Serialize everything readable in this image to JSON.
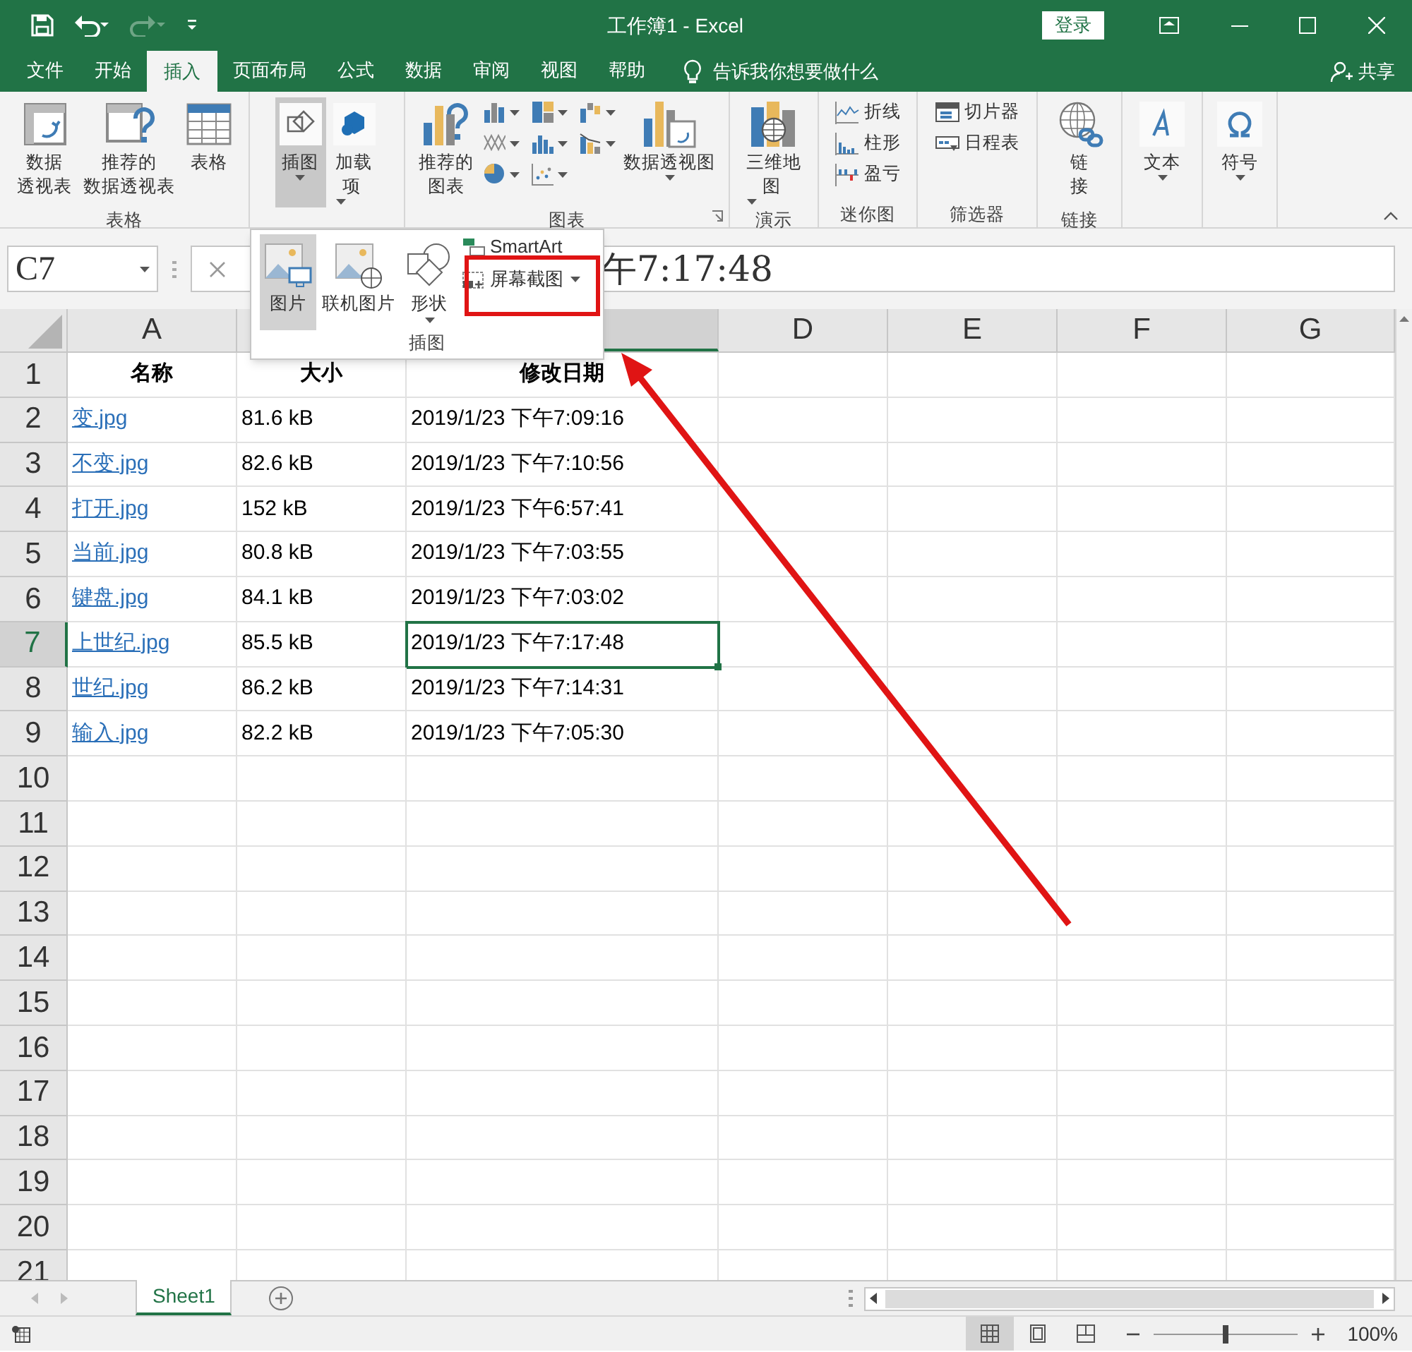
{
  "title_bar": {
    "title": "工作簿1 - Excel",
    "sign_in": "登录"
  },
  "quick_access": [
    {
      "kind": "save",
      "disabled": false
    },
    {
      "kind": "undo",
      "disabled": false
    },
    {
      "kind": "redo",
      "disabled": true
    },
    {
      "kind": "customize",
      "disabled": false
    }
  ],
  "tabs": [
    {
      "label": "文件",
      "selected": false
    },
    {
      "label": "开始",
      "selected": false
    },
    {
      "label": "插入",
      "selected": true
    },
    {
      "label": "页面布局",
      "selected": false
    },
    {
      "label": "公式",
      "selected": false
    },
    {
      "label": "数据",
      "selected": false
    },
    {
      "label": "审阅",
      "selected": false
    },
    {
      "label": "视图",
      "selected": false
    },
    {
      "label": "帮助",
      "selected": false
    }
  ],
  "tell_me": "告诉我你想要做什么",
  "share": "共享",
  "ribbon": {
    "groups": [
      {
        "label": "表格",
        "buttons": [
          {
            "kind": "large",
            "lines": [
              "数据",
              "透视表"
            ],
            "pressed": false
          },
          {
            "kind": "large",
            "lines": [
              "推荐的",
              "数据透视表"
            ],
            "pressed": false
          },
          {
            "kind": "large",
            "lines": [
              "表格"
            ],
            "pressed": false
          }
        ]
      },
      {
        "buttons": [
          {
            "kind": "large",
            "lines": [
              "插图"
            ],
            "dropdown": true,
            "pressed": true
          },
          {
            "kind": "large",
            "lines": [
              "加载",
              "项"
            ],
            "dropdown": true,
            "caret_inline": true,
            "pressed": false
          }
        ]
      },
      {
        "label": "图表",
        "launcher": true,
        "buttons": [
          {
            "kind": "large",
            "lines": [
              "推荐的",
              "图表"
            ],
            "pressed": false
          },
          {
            "kind": "chart",
            "pressed": false
          },
          {
            "kind": "chart",
            "pressed": false
          },
          {
            "kind": "chart",
            "pressed": false
          },
          {
            "kind": "chart",
            "pressed": false
          },
          {
            "kind": "chart",
            "pressed": false
          },
          {
            "kind": "chart",
            "pressed": false
          },
          {
            "kind": "chart",
            "pressed": false
          },
          {
            "kind": "chart",
            "pressed": false
          },
          {
            "kind": "large",
            "lines": [
              "数据透视图"
            ],
            "dropdown": true,
            "pressed": false
          }
        ]
      },
      {
        "label": "演示",
        "buttons": [
          {
            "kind": "large",
            "lines": [
              "三维地",
              "图"
            ],
            "dropdown": true,
            "caret_inline": true,
            "pressed": false
          }
        ]
      },
      {
        "label": "迷你图",
        "buttons": [
          {
            "kind": "small",
            "label": "折线",
            "pressed": false
          },
          {
            "kind": "small",
            "label": "柱形",
            "pressed": false
          },
          {
            "kind": "small",
            "label": "盈亏",
            "pressed": false
          }
        ]
      },
      {
        "label": "筛选器",
        "buttons": [
          {
            "kind": "small",
            "label": "切片器",
            "pressed": false
          },
          {
            "kind": "small",
            "label": "日程表",
            "pressed": false
          }
        ]
      },
      {
        "label": "链接",
        "buttons": [
          {
            "kind": "large",
            "lines": [
              "链",
              "接"
            ],
            "pressed": false
          }
        ]
      },
      {
        "buttons": [
          {
            "kind": "large",
            "lines": [
              "文本"
            ],
            "dropdown": true,
            "pressed": false
          }
        ]
      },
      {
        "buttons": [
          {
            "kind": "large",
            "lines": [
              "符号"
            ],
            "dropdown": true,
            "pressed": false
          }
        ]
      }
    ]
  },
  "dropdown": {
    "label": "插图",
    "items": [
      {
        "kind": "large",
        "label": "图片",
        "selected": true
      },
      {
        "kind": "large",
        "label": "联机图片",
        "selected": false
      },
      {
        "kind": "large",
        "label": "形状",
        "selected": false,
        "dropdown": true
      },
      {
        "kind": "small",
        "label": "SmartArt",
        "selected": false
      },
      {
        "kind": "small",
        "label": "屏幕截图",
        "selected": false,
        "dropdown": true
      }
    ]
  },
  "formula_bar": {
    "name_box": "C7",
    "value": "午7:17:48"
  },
  "columns": [
    {
      "label": "A",
      "selected": false
    },
    {
      "selected": true
    },
    {
      "label": "D",
      "selected": false
    },
    {
      "label": "E",
      "selected": false
    },
    {
      "label": "F",
      "selected": false
    },
    {
      "label": "G",
      "selected": false
    }
  ],
  "rows": [
    {
      "header": "1",
      "selected": false,
      "cells": [
        {
          "kind": "heading",
          "text": "名称"
        },
        {
          "kind": "heading",
          "text": "大小"
        },
        {
          "kind": "heading",
          "text": "修改日期"
        }
      ]
    },
    {
      "header": "2",
      "selected": false,
      "cells": [
        {
          "kind": "link",
          "text": "变.jpg"
        },
        {
          "kind": "text",
          "text": "81.6 kB"
        },
        {
          "kind": "text",
          "text": "2019/1/23 下午7:09:16"
        }
      ]
    },
    {
      "header": "3",
      "selected": false,
      "cells": [
        {
          "kind": "link",
          "text": "不变.jpg"
        },
        {
          "kind": "text",
          "text": "82.6 kB"
        },
        {
          "kind": "text",
          "text": "2019/1/23 下午7:10:56"
        }
      ]
    },
    {
      "header": "4",
      "selected": false,
      "cells": [
        {
          "kind": "link",
          "text": "打开.jpg"
        },
        {
          "kind": "text",
          "text": "152 kB"
        },
        {
          "kind": "text",
          "text": "2019/1/23 下午6:57:41"
        }
      ]
    },
    {
      "header": "5",
      "selected": false,
      "cells": [
        {
          "kind": "link",
          "text": "当前.jpg"
        },
        {
          "kind": "text",
          "text": "80.8 kB"
        },
        {
          "kind": "text",
          "text": "2019/1/23 下午7:03:55"
        }
      ]
    },
    {
      "header": "6",
      "selected": false,
      "cells": [
        {
          "kind": "link",
          "text": "键盘.jpg"
        },
        {
          "kind": "text",
          "text": "84.1 kB"
        },
        {
          "kind": "text",
          "text": "2019/1/23 下午7:03:02"
        }
      ]
    },
    {
      "header": "7",
      "selected": true,
      "cells": [
        {
          "kind": "link",
          "text": "上世纪.jpg"
        },
        {
          "kind": "text",
          "text": "85.5 kB"
        },
        {
          "kind": "text",
          "text": "2019/1/23 下午7:17:48",
          "selected": true
        }
      ]
    },
    {
      "header": "8",
      "selected": false,
      "cells": [
        {
          "kind": "link",
          "text": "世纪.jpg"
        },
        {
          "kind": "text",
          "text": "86.2 kB"
        },
        {
          "kind": "text",
          "text": "2019/1/23 下午7:14:31"
        }
      ]
    },
    {
      "header": "9",
      "selected": false,
      "cells": [
        {
          "kind": "link",
          "text": "输入.jpg"
        },
        {
          "kind": "text",
          "text": "82.2 kB"
        },
        {
          "kind": "text",
          "text": "2019/1/23 下午7:05:30"
        }
      ]
    },
    {
      "header": "10",
      "selected": false,
      "cells": []
    },
    {
      "header": "11",
      "selected": false,
      "cells": []
    },
    {
      "header": "12",
      "selected": false,
      "cells": []
    },
    {
      "header": "13",
      "selected": false,
      "cells": []
    },
    {
      "header": "14",
      "selected": false,
      "cells": []
    },
    {
      "header": "15",
      "selected": false,
      "cells": []
    },
    {
      "header": "16",
      "selected": false,
      "cells": []
    },
    {
      "header": "17",
      "selected": false,
      "cells": []
    },
    {
      "header": "18",
      "selected": false,
      "cells": []
    },
    {
      "header": "19",
      "selected": false,
      "cells": []
    },
    {
      "header": "20",
      "selected": false,
      "cells": []
    },
    {
      "header": "21",
      "selected": false,
      "cells": []
    }
  ],
  "sheet_tabs": [
    {
      "label": "Sheet1",
      "selected": true
    }
  ],
  "status_bar": {
    "views": [
      {
        "kind": "normal",
        "selected": true
      },
      {
        "kind": "page_layout",
        "selected": false
      },
      {
        "kind": "page_break",
        "selected": false
      }
    ],
    "zoom": {
      "level": 0.5,
      "reading": "100%"
    }
  }
}
